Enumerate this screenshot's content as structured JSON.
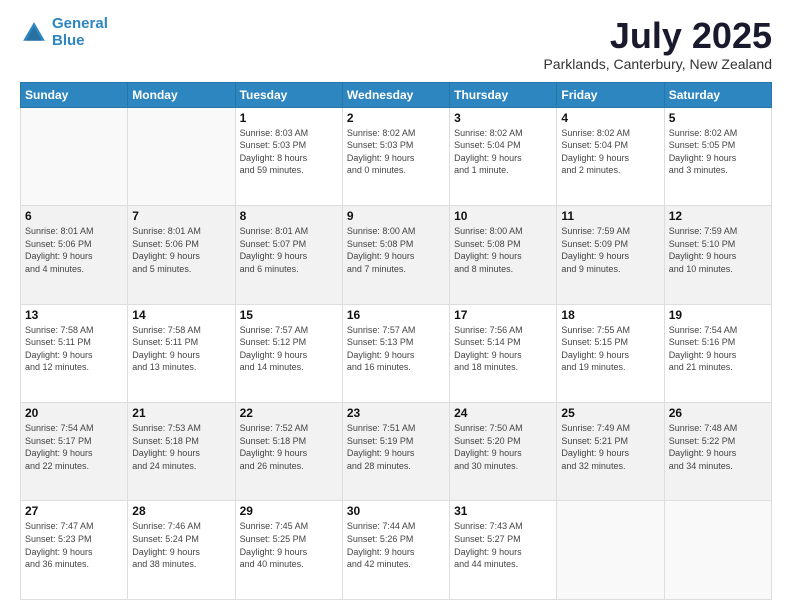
{
  "logo": {
    "line1": "General",
    "line2": "Blue"
  },
  "header": {
    "month": "July 2025",
    "location": "Parklands, Canterbury, New Zealand"
  },
  "weekdays": [
    "Sunday",
    "Monday",
    "Tuesday",
    "Wednesday",
    "Thursday",
    "Friday",
    "Saturday"
  ],
  "weeks": [
    [
      {
        "day": "",
        "info": ""
      },
      {
        "day": "",
        "info": ""
      },
      {
        "day": "1",
        "info": "Sunrise: 8:03 AM\nSunset: 5:03 PM\nDaylight: 8 hours\nand 59 minutes."
      },
      {
        "day": "2",
        "info": "Sunrise: 8:02 AM\nSunset: 5:03 PM\nDaylight: 9 hours\nand 0 minutes."
      },
      {
        "day": "3",
        "info": "Sunrise: 8:02 AM\nSunset: 5:04 PM\nDaylight: 9 hours\nand 1 minute."
      },
      {
        "day": "4",
        "info": "Sunrise: 8:02 AM\nSunset: 5:04 PM\nDaylight: 9 hours\nand 2 minutes."
      },
      {
        "day": "5",
        "info": "Sunrise: 8:02 AM\nSunset: 5:05 PM\nDaylight: 9 hours\nand 3 minutes."
      }
    ],
    [
      {
        "day": "6",
        "info": "Sunrise: 8:01 AM\nSunset: 5:06 PM\nDaylight: 9 hours\nand 4 minutes."
      },
      {
        "day": "7",
        "info": "Sunrise: 8:01 AM\nSunset: 5:06 PM\nDaylight: 9 hours\nand 5 minutes."
      },
      {
        "day": "8",
        "info": "Sunrise: 8:01 AM\nSunset: 5:07 PM\nDaylight: 9 hours\nand 6 minutes."
      },
      {
        "day": "9",
        "info": "Sunrise: 8:00 AM\nSunset: 5:08 PM\nDaylight: 9 hours\nand 7 minutes."
      },
      {
        "day": "10",
        "info": "Sunrise: 8:00 AM\nSunset: 5:08 PM\nDaylight: 9 hours\nand 8 minutes."
      },
      {
        "day": "11",
        "info": "Sunrise: 7:59 AM\nSunset: 5:09 PM\nDaylight: 9 hours\nand 9 minutes."
      },
      {
        "day": "12",
        "info": "Sunrise: 7:59 AM\nSunset: 5:10 PM\nDaylight: 9 hours\nand 10 minutes."
      }
    ],
    [
      {
        "day": "13",
        "info": "Sunrise: 7:58 AM\nSunset: 5:11 PM\nDaylight: 9 hours\nand 12 minutes."
      },
      {
        "day": "14",
        "info": "Sunrise: 7:58 AM\nSunset: 5:11 PM\nDaylight: 9 hours\nand 13 minutes."
      },
      {
        "day": "15",
        "info": "Sunrise: 7:57 AM\nSunset: 5:12 PM\nDaylight: 9 hours\nand 14 minutes."
      },
      {
        "day": "16",
        "info": "Sunrise: 7:57 AM\nSunset: 5:13 PM\nDaylight: 9 hours\nand 16 minutes."
      },
      {
        "day": "17",
        "info": "Sunrise: 7:56 AM\nSunset: 5:14 PM\nDaylight: 9 hours\nand 18 minutes."
      },
      {
        "day": "18",
        "info": "Sunrise: 7:55 AM\nSunset: 5:15 PM\nDaylight: 9 hours\nand 19 minutes."
      },
      {
        "day": "19",
        "info": "Sunrise: 7:54 AM\nSunset: 5:16 PM\nDaylight: 9 hours\nand 21 minutes."
      }
    ],
    [
      {
        "day": "20",
        "info": "Sunrise: 7:54 AM\nSunset: 5:17 PM\nDaylight: 9 hours\nand 22 minutes."
      },
      {
        "day": "21",
        "info": "Sunrise: 7:53 AM\nSunset: 5:18 PM\nDaylight: 9 hours\nand 24 minutes."
      },
      {
        "day": "22",
        "info": "Sunrise: 7:52 AM\nSunset: 5:18 PM\nDaylight: 9 hours\nand 26 minutes."
      },
      {
        "day": "23",
        "info": "Sunrise: 7:51 AM\nSunset: 5:19 PM\nDaylight: 9 hours\nand 28 minutes."
      },
      {
        "day": "24",
        "info": "Sunrise: 7:50 AM\nSunset: 5:20 PM\nDaylight: 9 hours\nand 30 minutes."
      },
      {
        "day": "25",
        "info": "Sunrise: 7:49 AM\nSunset: 5:21 PM\nDaylight: 9 hours\nand 32 minutes."
      },
      {
        "day": "26",
        "info": "Sunrise: 7:48 AM\nSunset: 5:22 PM\nDaylight: 9 hours\nand 34 minutes."
      }
    ],
    [
      {
        "day": "27",
        "info": "Sunrise: 7:47 AM\nSunset: 5:23 PM\nDaylight: 9 hours\nand 36 minutes."
      },
      {
        "day": "28",
        "info": "Sunrise: 7:46 AM\nSunset: 5:24 PM\nDaylight: 9 hours\nand 38 minutes."
      },
      {
        "day": "29",
        "info": "Sunrise: 7:45 AM\nSunset: 5:25 PM\nDaylight: 9 hours\nand 40 minutes."
      },
      {
        "day": "30",
        "info": "Sunrise: 7:44 AM\nSunset: 5:26 PM\nDaylight: 9 hours\nand 42 minutes."
      },
      {
        "day": "31",
        "info": "Sunrise: 7:43 AM\nSunset: 5:27 PM\nDaylight: 9 hours\nand 44 minutes."
      },
      {
        "day": "",
        "info": ""
      },
      {
        "day": "",
        "info": ""
      }
    ]
  ]
}
